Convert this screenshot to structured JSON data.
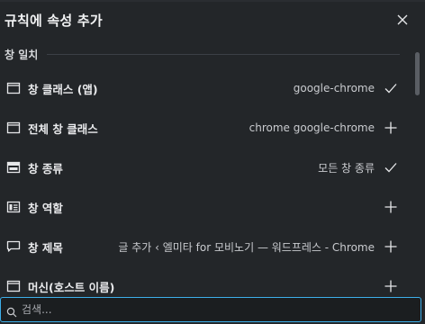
{
  "dialog": {
    "title": "규칙에 속성 추가",
    "close_icon": "close-icon"
  },
  "section": {
    "title": "창 일치"
  },
  "rows": [
    {
      "label": "창 클래스 (앱)",
      "value": "google-chrome",
      "icon": "window-icon",
      "action": "check-icon"
    },
    {
      "label": "전체 창 클래스",
      "value": "chrome google-chrome",
      "icon": "window-icon",
      "action": "plus-icon"
    },
    {
      "label": "창 종류",
      "value": "모든 창 종류",
      "icon": "window-type-icon",
      "action": "check-icon"
    },
    {
      "label": "창 역할",
      "value": "",
      "icon": "window-role-icon",
      "action": "plus-icon"
    },
    {
      "label": "창 제목",
      "value": "글 추가 ‹ 엘미타 for 모비노기 — 워드프레스 - Chrome",
      "icon": "speech-bubble-icon",
      "action": "plus-icon"
    },
    {
      "label": "머신(호스트 이름)",
      "value": "",
      "icon": "window-icon",
      "action": "plus-icon"
    }
  ],
  "search": {
    "placeholder": "검색...",
    "value": ""
  },
  "colors": {
    "background": "#232629",
    "accent": "#3daee9",
    "text": "#e9eaec"
  }
}
